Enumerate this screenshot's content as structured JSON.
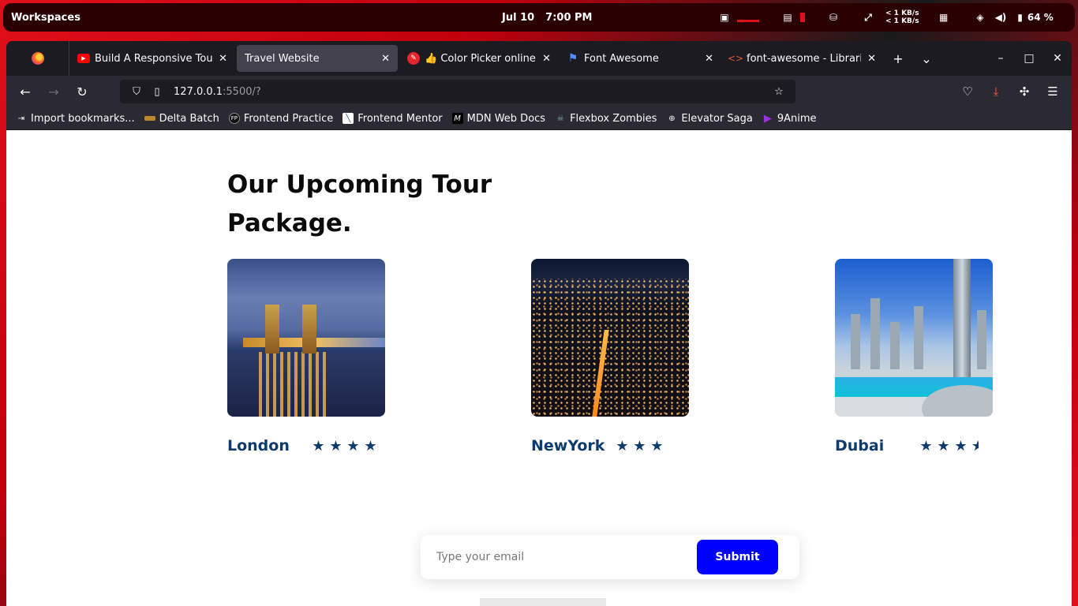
{
  "topbar": {
    "workspaces": "Workspaces",
    "date": "Jul 10",
    "time": "7:00 PM",
    "net_up": "< 1 KB/s",
    "net_down": "< 1 KB/s",
    "battery": "64 %"
  },
  "tabs": [
    {
      "title": "Build A Responsive Tour",
      "favicon": "youtube-icon",
      "active": false
    },
    {
      "title": "Travel Website",
      "favicon": "",
      "active": true
    },
    {
      "title": "👍 Color Picker online | H",
      "favicon": "color-picker-icon",
      "active": false
    },
    {
      "title": "Font Awesome",
      "favicon": "flag-icon",
      "active": false
    },
    {
      "title": "font-awesome - Libraries",
      "favicon": "code-icon",
      "active": false
    }
  ],
  "url": {
    "host": "127.0.0.1",
    "rest": ":5500/?"
  },
  "bookmarks": [
    {
      "label": "Import bookmarks...",
      "icon": "import-icon"
    },
    {
      "label": "Delta Batch",
      "icon": "delta-icon"
    },
    {
      "label": "Frontend Practice",
      "icon": "fp-icon"
    },
    {
      "label": "Frontend Mentor",
      "icon": "frontend-mentor-icon"
    },
    {
      "label": "MDN Web Docs",
      "icon": "mdn-icon"
    },
    {
      "label": "Flexbox Zombies",
      "icon": "zombie-icon"
    },
    {
      "label": "Elevator Saga",
      "icon": "globe-icon"
    },
    {
      "label": "9Anime",
      "icon": "play-icon"
    }
  ],
  "page": {
    "heading": "Our Upcoming Tour Package.",
    "cards": [
      {
        "city": "London",
        "rating": 4
      },
      {
        "city": "NewYork",
        "rating": 3
      },
      {
        "city": "Dubai",
        "rating": 3.5
      }
    ],
    "subscribe": {
      "placeholder": "Type your email",
      "button": "Submit"
    }
  },
  "colors": {
    "accent": "#0000ff",
    "city_text": "#0d3b6e"
  }
}
